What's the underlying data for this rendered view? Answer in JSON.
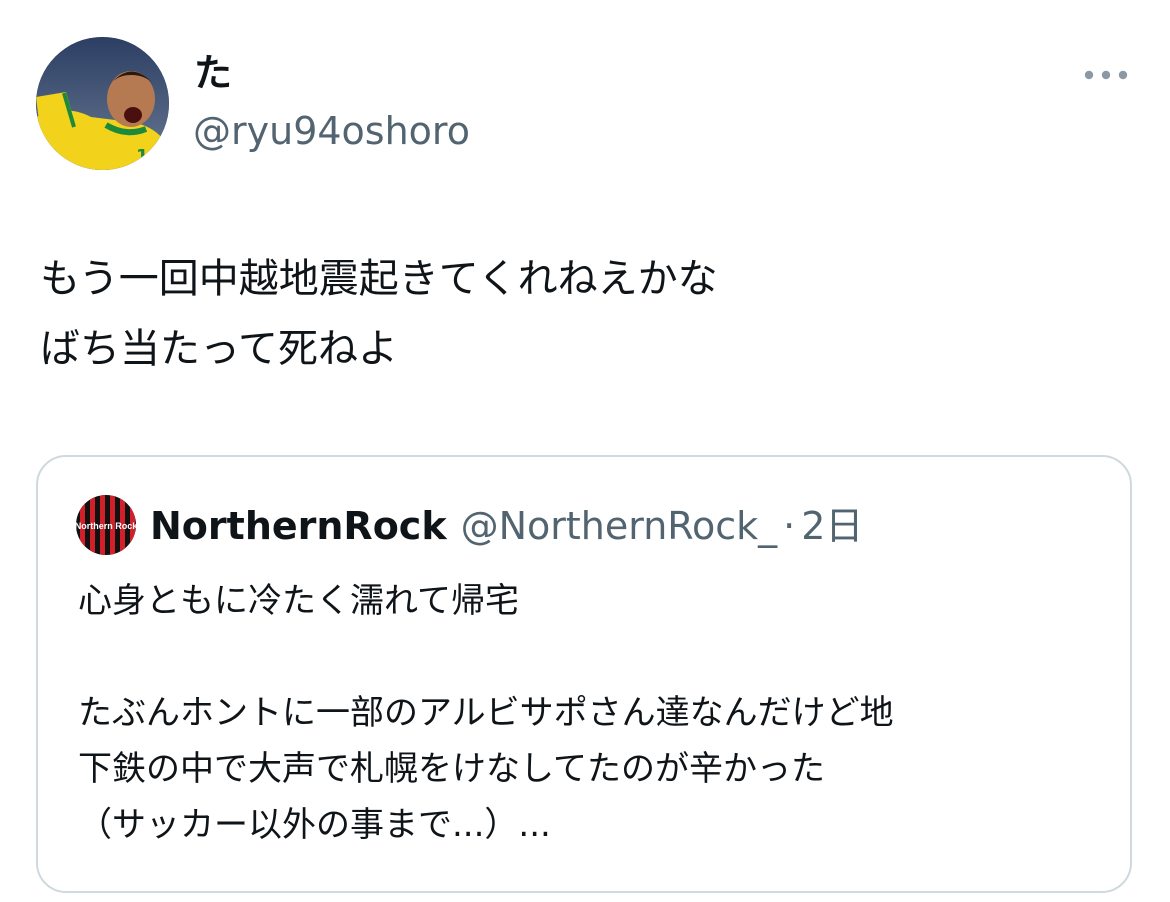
{
  "author": {
    "display_name": "た",
    "handle": "@ryu94oshoro",
    "avatar_icon": "soccer-player-avatar"
  },
  "more_icon": "more-options-icon",
  "tweet": {
    "lines": [
      "もう一回中越地震起きてくれねえかな",
      "ばち当たって死ねよ"
    ]
  },
  "quote": {
    "display_name": "NorthernRock",
    "handle": "@NorthernRock_",
    "separator": "·",
    "time": "2日",
    "avatar_text": "Northern Rock",
    "text_lines": [
      "心身ともに冷たく濡れて帰宅",
      "",
      "たぶんホントに一部のアルビサポさん達なんだけど地",
      "下鉄の中で大声で札幌をけなしてたのが辛かった",
      "（サッカー以外の事まで...）..."
    ]
  },
  "colors": {
    "text_primary": "#0f1419",
    "text_secondary": "#536471",
    "border": "#cfd9de"
  }
}
